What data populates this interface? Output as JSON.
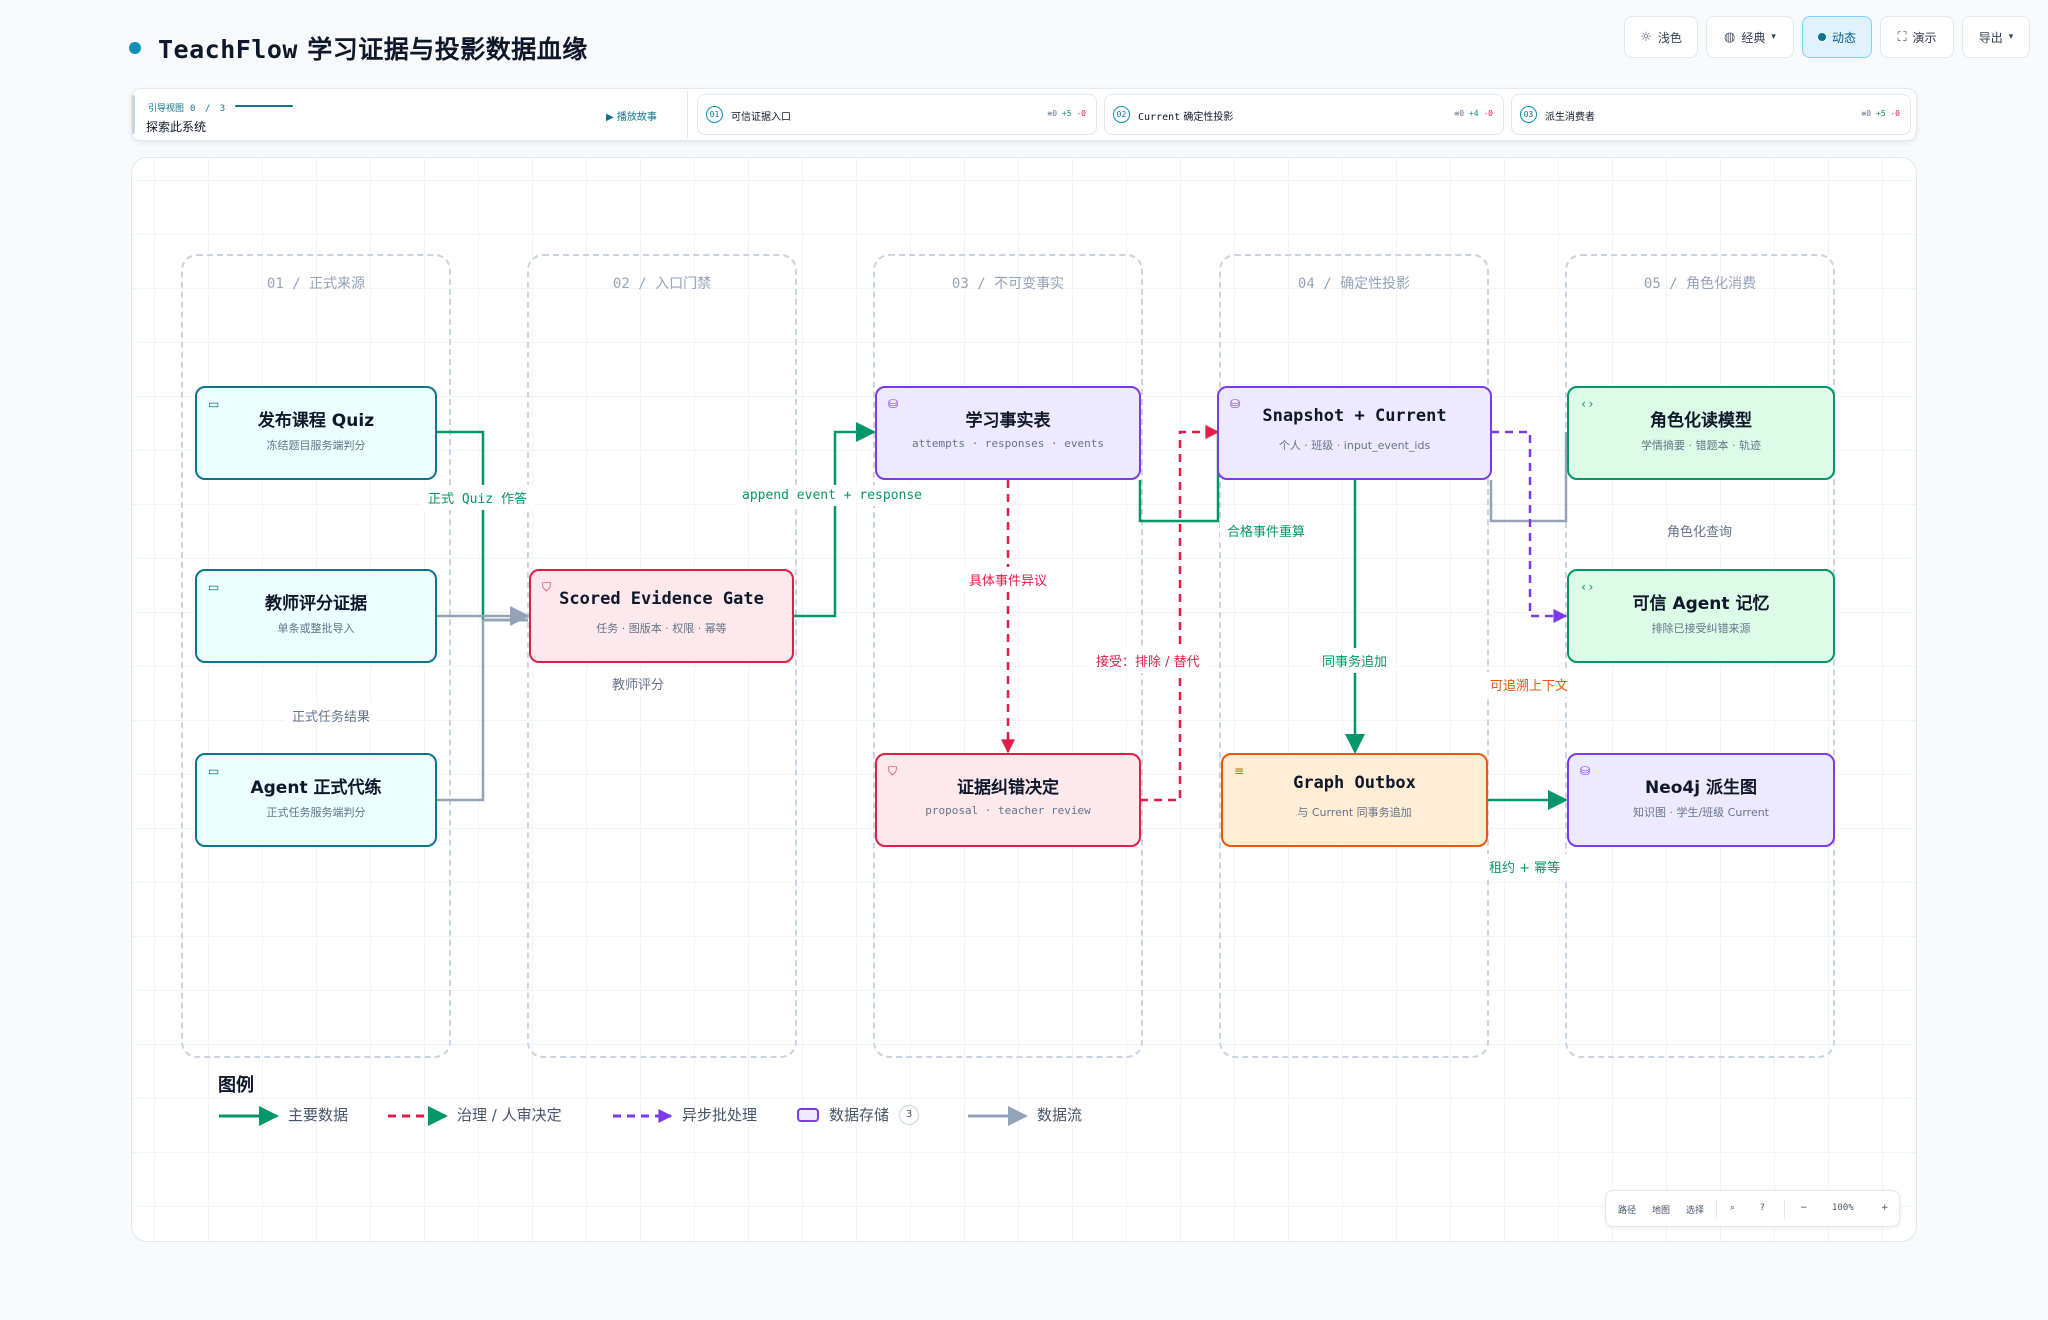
{
  "header": {
    "brand": "TeachFlow",
    "title": "学习证据与投影数据血缘"
  },
  "toolbar": {
    "light": "浅色",
    "classic": "经典",
    "dynamic": "动态",
    "present": "演示",
    "export": "导出"
  },
  "guide": {
    "label": "引导视图",
    "progress": "0 / 3",
    "subtitle": "探索此系统",
    "play": "播放故事",
    "steps": [
      {
        "num": "01",
        "label": "可信证据入口",
        "counts": "≡0 +5 -0"
      },
      {
        "num": "02",
        "label": "Current 确定性投影",
        "counts": "≡0 +4 -0"
      },
      {
        "num": "03",
        "label": "派生消费者",
        "counts": "≡0 +5 -0"
      }
    ]
  },
  "lanes": [
    "01 / 正式来源",
    "02 / 入口门禁",
    "03 / 不可变事实",
    "04 / 确定性投影",
    "05 / 角色化消费"
  ],
  "nodes": {
    "quiz": {
      "title": "发布课程 Quiz",
      "sub": "冻结题目服务端判分",
      "icon": "window-icon"
    },
    "teacher": {
      "title": "教师评分证据",
      "sub": "单条或整批导入",
      "icon": "window-icon"
    },
    "agent": {
      "title": "Agent 正式代练",
      "sub": "正式任务服务端判分",
      "icon": "window-icon"
    },
    "gate": {
      "title": "Scored Evidence Gate",
      "sub": "任务 · 图版本 · 权限 · 幂等",
      "icon": "shield-icon"
    },
    "facts": {
      "title": "学习事实表",
      "sub": "attempts · responses · events",
      "icon": "database-icon"
    },
    "correction": {
      "title": "证据纠错决定",
      "sub": "proposal · teacher review",
      "icon": "shield-icon"
    },
    "snapshot": {
      "title": "Snapshot + Current",
      "sub": "个人 · 班级 · input_event_ids",
      "icon": "database-icon"
    },
    "outbox": {
      "title": "Graph Outbox",
      "sub": "与 Current 同事务追加",
      "icon": "list-icon"
    },
    "role_model": {
      "title": "角色化读模型",
      "sub": "学情摘要 · 错题本 · 轨迹",
      "icon": "code-icon"
    },
    "memory": {
      "title": "可信 Agent 记忆",
      "sub": "排除已接受纠错来源",
      "icon": "code-icon"
    },
    "neo4j": {
      "title": "Neo4j 派生图",
      "sub": "知识图 · 学生/班级 Current",
      "icon": "database-icon"
    }
  },
  "edge_labels": {
    "formal_quiz": "正式 Quiz 作答",
    "formal_task": "正式任务结果",
    "teacher_score": "教师评分",
    "append": "append event + response",
    "dispute": "具体事件异议",
    "accept": "接受：排除 / 替代",
    "recompute": "合格事件重算",
    "same_tx": "同事务追加",
    "role_query": "角色化查询",
    "traceable": "可追溯上下文",
    "lease": "租约 + 幂等"
  },
  "legend": {
    "title": "图例",
    "main": "主要数据",
    "governance": "治理 / 人审决定",
    "async": "异步批处理",
    "store": "数据存储",
    "store_count": "3",
    "flow": "数据流"
  },
  "zoombar": {
    "path": "路径",
    "map": "地图",
    "select": "选择",
    "zoom": "100%",
    "minus": "−",
    "plus": "+"
  },
  "colors": {
    "main": "#059669",
    "governance": "#e11d48",
    "async": "#7c3aed",
    "flow": "#94a3b8",
    "accent": "#0e7490"
  }
}
